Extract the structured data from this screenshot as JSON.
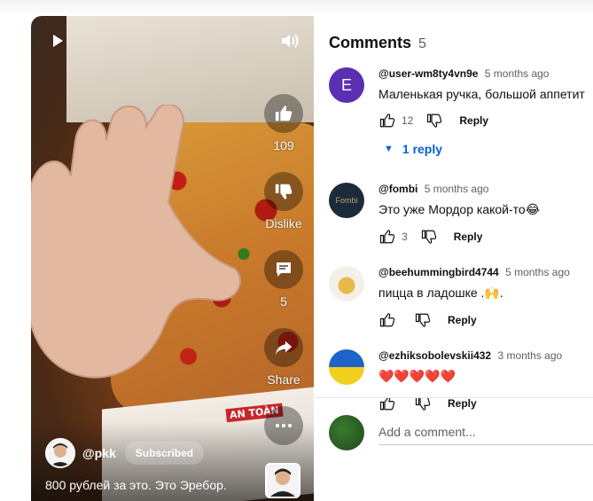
{
  "player": {
    "channel_name": "@pkk",
    "subscribe_label": "Subscribed",
    "title": "800 рублей за это. Это Эребор.",
    "box_label": "AN TOÀN",
    "actions": {
      "like_count": "109",
      "dislike_label": "Dislike",
      "comments_count": "5",
      "share_label": "Share"
    }
  },
  "comments": {
    "title": "Comments",
    "count": "5",
    "items": [
      {
        "author": "@user-wm8ty4vn9e",
        "time": "5 months ago",
        "text": "Маленькая ручка, большой аппетит",
        "likes": "12",
        "reply_label": "Reply",
        "avatar_letter": "E",
        "avatar_color": "#5b2fb3",
        "replies_label": "1 reply"
      },
      {
        "author": "@fombi",
        "time": "5 months ago",
        "text": "Это уже Мордор какой-то😂",
        "likes": "3",
        "reply_label": "Reply",
        "avatar_text": "Fombi",
        "avatar_color": "#1c2b3a"
      },
      {
        "author": "@beehummingbird4744",
        "time": "5 months ago",
        "text": "пицца в ладошке .🙌.",
        "likes": "",
        "reply_label": "Reply"
      },
      {
        "author": "@ezhiksobolevskii432",
        "time": "3 months ago",
        "text": "❤️❤️❤️❤️❤️",
        "likes": "",
        "reply_label": "Reply"
      }
    ],
    "add_placeholder": "Add a comment..."
  },
  "icons": {
    "play": "play-icon",
    "volume": "volume-icon",
    "like": "thumbs-up-icon",
    "dislike": "thumbs-down-icon",
    "comment": "comment-icon",
    "share": "share-icon",
    "more": "more-icon",
    "expand": "chevron-down-icon"
  },
  "colors": {
    "link_blue": "#065fd4",
    "text_primary": "#0f0f0f",
    "text_secondary": "#606060"
  }
}
